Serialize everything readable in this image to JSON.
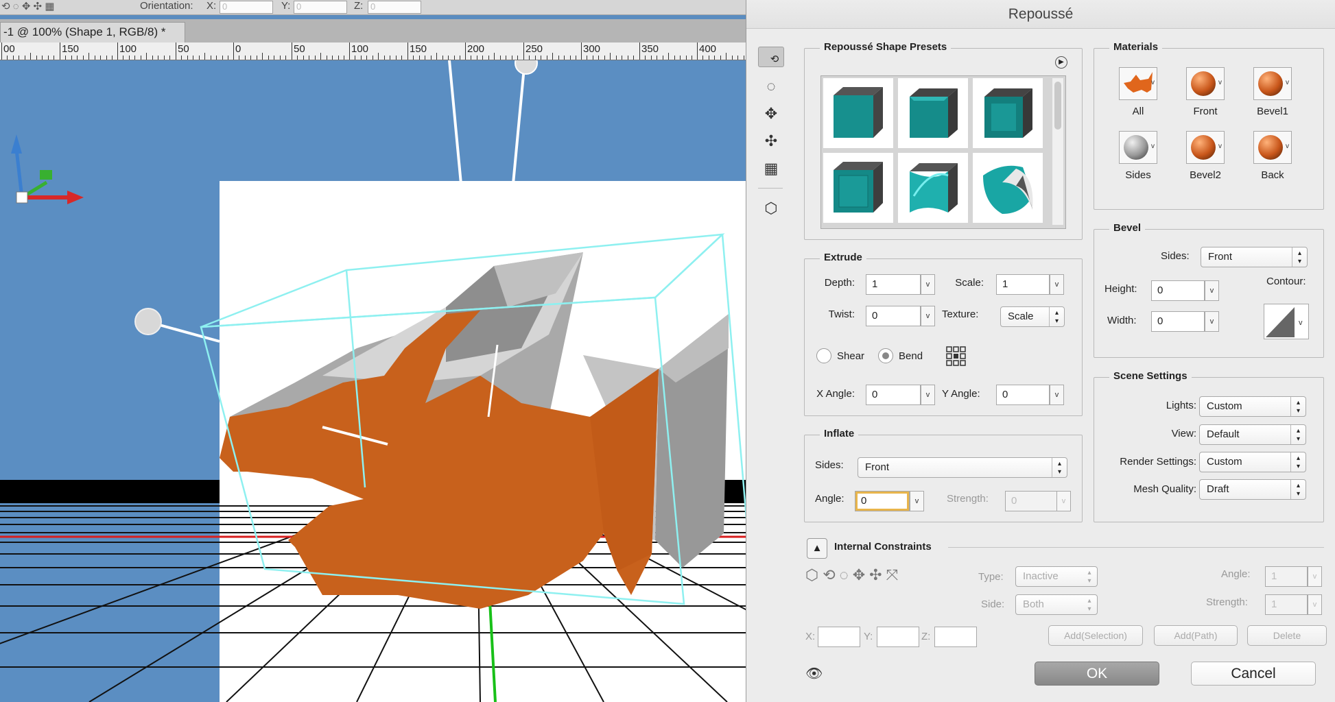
{
  "options_bar": {
    "orientation_label": "Orientation:",
    "x_label": "X:",
    "y_label": "Y:",
    "z_label": "Z:",
    "x_value": "0",
    "y_value": "0",
    "z_value": "0"
  },
  "doc_tab": {
    "title": "-1 @ 100% (Shape 1, RGB/8) *"
  },
  "ruler": {
    "labels": [
      "00",
      "150",
      "100",
      "50",
      "0",
      "50",
      "100",
      "150",
      "200",
      "250",
      "300",
      "350",
      "400"
    ]
  },
  "dialog": {
    "title": "Repoussé",
    "presets": {
      "title": "Repoussé Shape Presets"
    },
    "materials": {
      "title": "Materials",
      "items": [
        {
          "label": "All",
          "color": "#e0661c"
        },
        {
          "label": "Front",
          "color": "#d2601c"
        },
        {
          "label": "Bevel1",
          "color": "#d2601c"
        },
        {
          "label": "Sides",
          "color": "#9a9a9a"
        },
        {
          "label": "Bevel2",
          "color": "#d2601c"
        },
        {
          "label": "Back",
          "color": "#d2601c"
        }
      ]
    },
    "extrude": {
      "title": "Extrude",
      "depth_label": "Depth:",
      "depth": "1",
      "scale_label": "Scale:",
      "scale": "1",
      "twist_label": "Twist:",
      "twist": "0",
      "texture_label": "Texture:",
      "texture": "Scale",
      "shear_label": "Shear",
      "bend_label": "Bend",
      "x_angle_label": "X Angle:",
      "x_angle": "0",
      "y_angle_label": "Y Angle:",
      "y_angle": "0"
    },
    "inflate": {
      "title": "Inflate",
      "sides_label": "Sides:",
      "sides": "Front",
      "angle_label": "Angle:",
      "angle": "0",
      "strength_label": "Strength:",
      "strength": "0"
    },
    "bevel": {
      "title": "Bevel",
      "sides_label": "Sides:",
      "sides": "Front",
      "height_label": "Height:",
      "height": "0",
      "width_label": "Width:",
      "width": "0",
      "contour_label": "Contour:"
    },
    "scene": {
      "title": "Scene Settings",
      "lights_label": "Lights:",
      "lights": "Custom",
      "view_label": "View:",
      "view": "Default",
      "render_label": "Render Settings:",
      "render": "Custom",
      "mesh_label": "Mesh Quality:",
      "mesh": "Draft"
    },
    "constraints": {
      "title": "Internal Constraints",
      "type_label": "Type:",
      "type": "Inactive",
      "side_label": "Side:",
      "side": "Both",
      "angle_label": "Angle:",
      "angle": "1",
      "strength_label": "Strength:",
      "strength": "1",
      "x_label": "X:",
      "y_label": "Y:",
      "z_label": "Z:",
      "add_selection": "Add(Selection)",
      "add_path": "Add(Path)",
      "delete": "Delete"
    },
    "ok": "OK",
    "cancel": "Cancel"
  }
}
